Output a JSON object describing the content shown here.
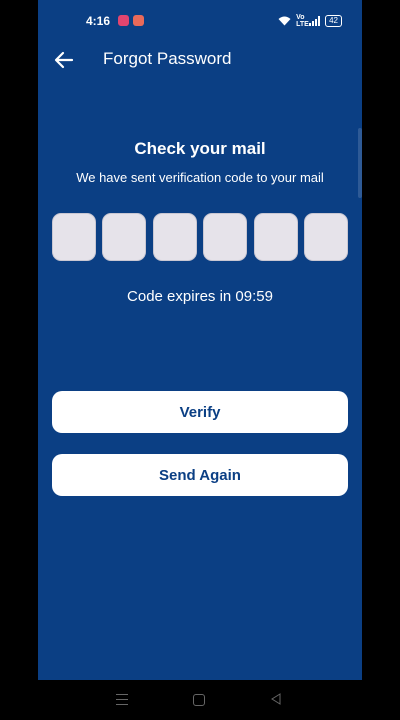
{
  "status_bar": {
    "time": "4:16",
    "network": "Vo LTE",
    "battery": "42"
  },
  "app_bar": {
    "title": "Forgot Password",
    "back_icon": "arrow-left-icon"
  },
  "content": {
    "heading": "Check your mail",
    "subheading": "We have sent verification code to your mail",
    "otp": {
      "length": 6,
      "values": [
        "",
        "",
        "",
        "",
        "",
        ""
      ]
    },
    "expiry_text": "Code expires in 09:59"
  },
  "buttons": {
    "verify_label": "Verify",
    "send_again_label": "Send Again"
  },
  "colors": {
    "background": "#0b3f84",
    "button_background": "#ffffff",
    "button_text": "#0b3f84",
    "otp_box": "#e6e3ea"
  },
  "system_nav": {
    "icons": [
      "menu-icon",
      "home-icon",
      "back-triangle-icon"
    ]
  }
}
